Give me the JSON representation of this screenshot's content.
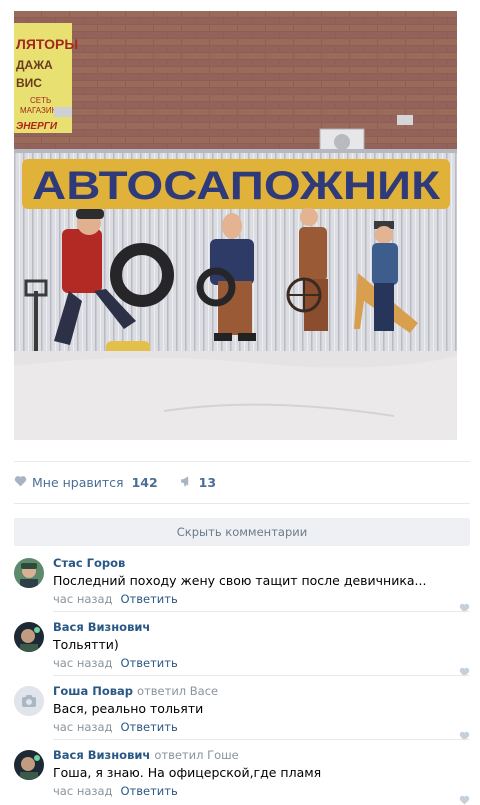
{
  "post": {
    "image_text": {
      "banner": "АВТОСАПОЖНИК",
      "side_sign_lines": [
        "ЛЯТОРЫ",
        "ДАЖА",
        "ВИС",
        "СЕТЬ",
        "МАГАЗИН",
        "ЭНЕРГИ"
      ]
    },
    "likes_label": "Мне нравится",
    "likes_count": "142",
    "shares_count": "13"
  },
  "hide_comments_label": "Скрыть комментарии",
  "comments": [
    {
      "author": "Стас Горов",
      "reply_to": "",
      "text": "Последний походу жену свою тащит после девичника...",
      "time": "час назад",
      "reply_label": "Ответить",
      "avatar": "photo"
    },
    {
      "author": "Вася Визнович",
      "reply_to": "",
      "text": "Тольятти)",
      "time": "час назад",
      "reply_label": "Ответить",
      "avatar": "photo"
    },
    {
      "author": "Гоша Повар",
      "reply_to": "ответил Васе",
      "text": "Вася, реально тольяти",
      "time": "час назад",
      "reply_label": "Ответить",
      "avatar": "camera-placeholder"
    },
    {
      "author": "Вася Визнович",
      "reply_to": "ответил Гоше",
      "text": "Гоша, я знаю. На офицерской,где пламя",
      "time": "час назад",
      "reply_label": "Ответить",
      "avatar": "photo"
    }
  ],
  "colors": {
    "link": "#2a5885",
    "muted": "#8a939c",
    "action": "#4a6e97",
    "separator": "#e7e8ec",
    "hide_bg": "#eef0f3"
  },
  "icons": {
    "like": "heart-icon",
    "share": "megaphone-icon",
    "camera": "camera-icon"
  }
}
